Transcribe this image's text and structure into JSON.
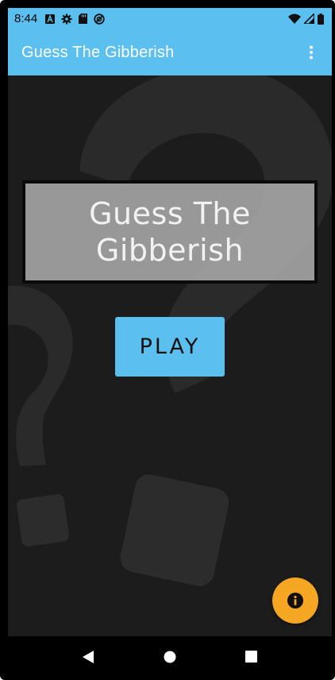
{
  "status_bar": {
    "time": "8:44",
    "left_icons": [
      "text-a-icon",
      "gear-icon",
      "sd-card-icon",
      "sync-blocked-icon"
    ],
    "right_icons": [
      "wifi-icon",
      "signal-icon",
      "battery-icon"
    ]
  },
  "app_bar": {
    "title": "Guess The Gibberish",
    "menu_icon": "more-vert-icon"
  },
  "main": {
    "title_line_1": "Guess The",
    "title_line_2": "Gibberish",
    "play_label": "PLAY",
    "fab_icon": "info-icon"
  },
  "nav_bar": {
    "buttons": [
      "back-icon",
      "home-icon",
      "recents-icon"
    ]
  },
  "colors": {
    "accent": "#5bc0f0",
    "fab": "#f5a623",
    "background": "#1c1c1c"
  }
}
